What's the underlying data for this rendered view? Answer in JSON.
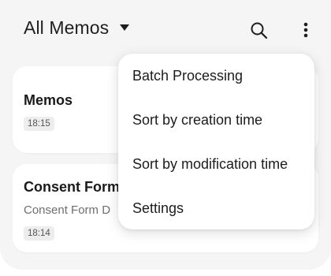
{
  "header": {
    "title": "All Memos",
    "search_icon": "search-icon",
    "more_icon": "more-vertical-icon",
    "dropdown_icon": "caret-down-icon"
  },
  "memos": [
    {
      "title": "Memos",
      "preview": "",
      "time": "18:15"
    },
    {
      "title": "Consent Form",
      "preview": "Consent Form  D",
      "time": "18:14"
    }
  ],
  "menu": {
    "items": [
      "Batch Processing",
      "Sort by creation time",
      "Sort by modification time",
      "Settings"
    ]
  },
  "colors": {
    "background": "#f5f5f5",
    "card": "#ffffff",
    "text": "#1e1e1e",
    "muted_text": "#6e6e6e"
  }
}
